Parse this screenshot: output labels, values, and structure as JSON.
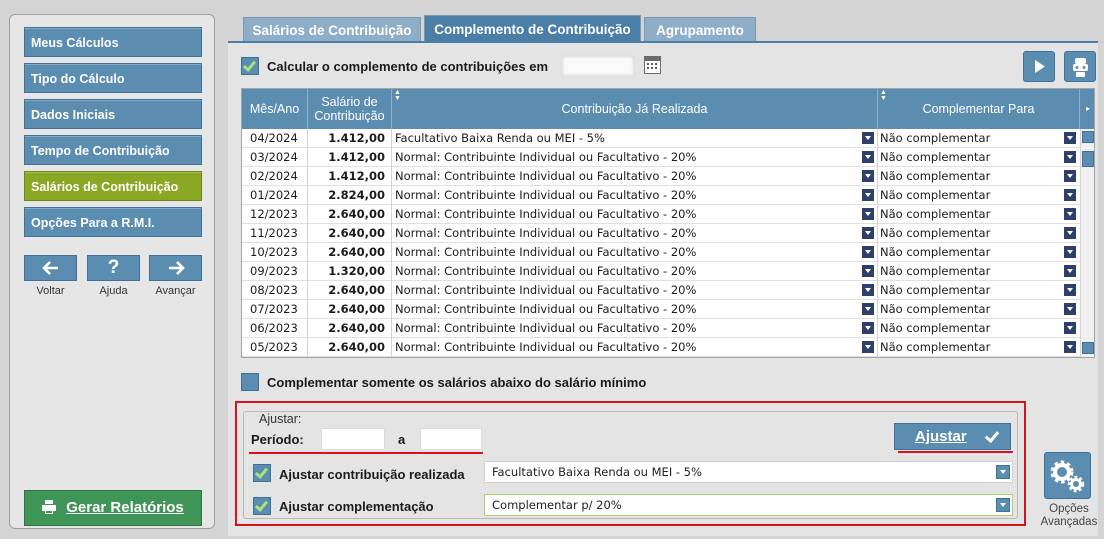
{
  "nav": {
    "items": [
      {
        "label": "Meus Cálculos",
        "active": false
      },
      {
        "label": "Tipo do Cálculo",
        "active": false
      },
      {
        "label": "Dados Iniciais",
        "active": false
      },
      {
        "label": "Tempo de Contribuição",
        "active": false
      },
      {
        "label": "Salários de Contribuição",
        "active": true
      },
      {
        "label": "Opções Para a R.M.I.",
        "active": false
      }
    ],
    "back_label": "Voltar",
    "help_label": "Ajuda",
    "help_symbol": "?",
    "forward_label": "Avançar",
    "report_label": "Gerar Relatórios",
    "active_color": "#8aa823",
    "button_color": "#5b8db1"
  },
  "tabs": [
    {
      "label": "Salários de Contribuição",
      "active": false
    },
    {
      "label": "Complemento de Contribuição",
      "active": true
    },
    {
      "label": "Agrupamento",
      "active": false
    }
  ],
  "calc": {
    "checkbox_label": "Calcular o complemento de contribuições em",
    "checked": true
  },
  "table": {
    "columns": [
      "Mês/Ano",
      "Salário de Contribuição",
      "Contribuição Já Realizada",
      "Complementar Para"
    ],
    "rows": [
      {
        "mes": "04/2024",
        "salario": "1.412,00",
        "contribuicao": "Facultativo Baixa Renda ou MEI - 5%",
        "complementar": "Não complementar"
      },
      {
        "mes": "03/2024",
        "salario": "1.412,00",
        "contribuicao": "Normal: Contribuinte Individual ou Facultativo - 20%",
        "complementar": "Não complementar"
      },
      {
        "mes": "02/2024",
        "salario": "1.412,00",
        "contribuicao": "Normal: Contribuinte Individual ou Facultativo - 20%",
        "complementar": "Não complementar"
      },
      {
        "mes": "01/2024",
        "salario": "2.824,00",
        "contribuicao": "Normal: Contribuinte Individual ou Facultativo - 20%",
        "complementar": "Não complementar"
      },
      {
        "mes": "12/2023",
        "salario": "2.640,00",
        "contribuicao": "Normal: Contribuinte Individual ou Facultativo - 20%",
        "complementar": "Não complementar"
      },
      {
        "mes": "11/2023",
        "salario": "2.640,00",
        "contribuicao": "Normal: Contribuinte Individual ou Facultativo - 20%",
        "complementar": "Não complementar"
      },
      {
        "mes": "10/2023",
        "salario": "2.640,00",
        "contribuicao": "Normal: Contribuinte Individual ou Facultativo - 20%",
        "complementar": "Não complementar"
      },
      {
        "mes": "09/2023",
        "salario": "1.320,00",
        "contribuicao": "Normal: Contribuinte Individual ou Facultativo - 20%",
        "complementar": "Não complementar"
      },
      {
        "mes": "08/2023",
        "salario": "2.640,00",
        "contribuicao": "Normal: Contribuinte Individual ou Facultativo - 20%",
        "complementar": "Não complementar"
      },
      {
        "mes": "07/2023",
        "salario": "2.640,00",
        "contribuicao": "Normal: Contribuinte Individual ou Facultativo - 20%",
        "complementar": "Não complementar"
      },
      {
        "mes": "06/2023",
        "salario": "2.640,00",
        "contribuicao": "Normal: Contribuinte Individual ou Facultativo - 20%",
        "complementar": "Não complementar"
      },
      {
        "mes": "05/2023",
        "salario": "2.640,00",
        "contribuicao": "Normal: Contribuinte Individual ou Facultativo - 20%",
        "complementar": "Não complementar"
      }
    ]
  },
  "below_min": {
    "label": "Complementar somente os salários abaixo do salário mínimo",
    "checked": false
  },
  "adjust": {
    "legend": "Ajustar:",
    "periodo_label": "Período:",
    "a_label": "a",
    "button_label": "Ajustar",
    "contrib_label": "Ajustar contribuição realizada",
    "contrib_value": "Facultativo Baixa Renda ou MEI - 5%",
    "contrib_checked": true,
    "compl_label": "Ajustar complementação",
    "compl_value": "Complementar p/ 20%",
    "compl_checked": true,
    "highlight_color": "#d3141c"
  },
  "opcoes": {
    "label_line1": "Opções",
    "label_line2": "Avançadas"
  },
  "icons": [
    "play-icon",
    "robot-icon",
    "calendar-icon",
    "printer-icon",
    "gears-icon",
    "arrow-left-icon",
    "arrow-right-icon",
    "help-icon"
  ]
}
